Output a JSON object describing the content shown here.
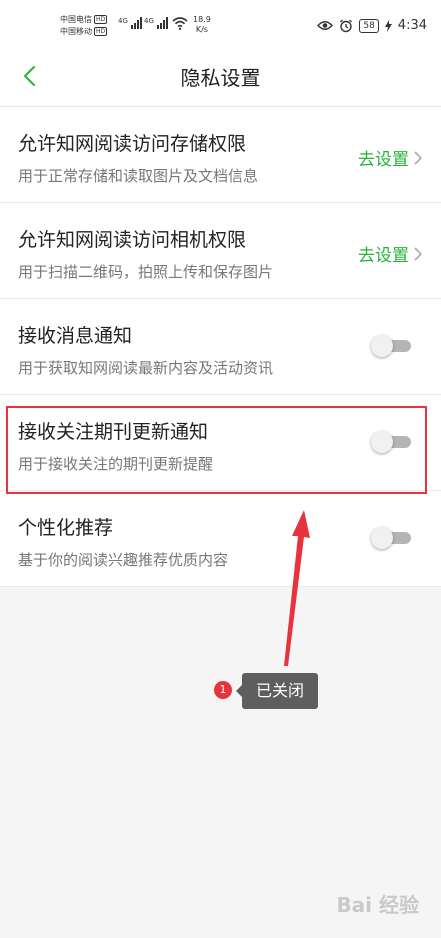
{
  "status_bar": {
    "carrier1": "中国电信",
    "carrier2": "中国移动",
    "hd": "HD",
    "net1": "4G",
    "net2": "4G",
    "speed_value": "18.9",
    "speed_unit": "K/s",
    "battery": "58",
    "time": "4:34"
  },
  "header": {
    "title": "隐私设置"
  },
  "rows": [
    {
      "title": "允许知网阅读访问存储权限",
      "desc": "用于正常存储和读取图片及文档信息",
      "action": "去设置"
    },
    {
      "title": "允许知网阅读访问相机权限",
      "desc": "用于扫描二维码，拍照上传和保存图片",
      "action": "去设置"
    },
    {
      "title": "接收消息通知",
      "desc": "用于获取知网阅读最新内容及活动资讯",
      "toggle_on": false
    },
    {
      "title": "接收关注期刊更新通知",
      "desc": "用于接收关注的期刊更新提醒",
      "toggle_on": false
    },
    {
      "title": "个性化推荐",
      "desc": "基于你的阅读兴趣推荐优质内容",
      "toggle_on": false
    }
  ],
  "annotation": {
    "badge": "1",
    "text": "已关闭"
  },
  "watermark": "Bai 经验",
  "colors": {
    "accent": "#28b33b",
    "highlight": "#e8323c",
    "toggle_off": "#b5b5b5"
  }
}
